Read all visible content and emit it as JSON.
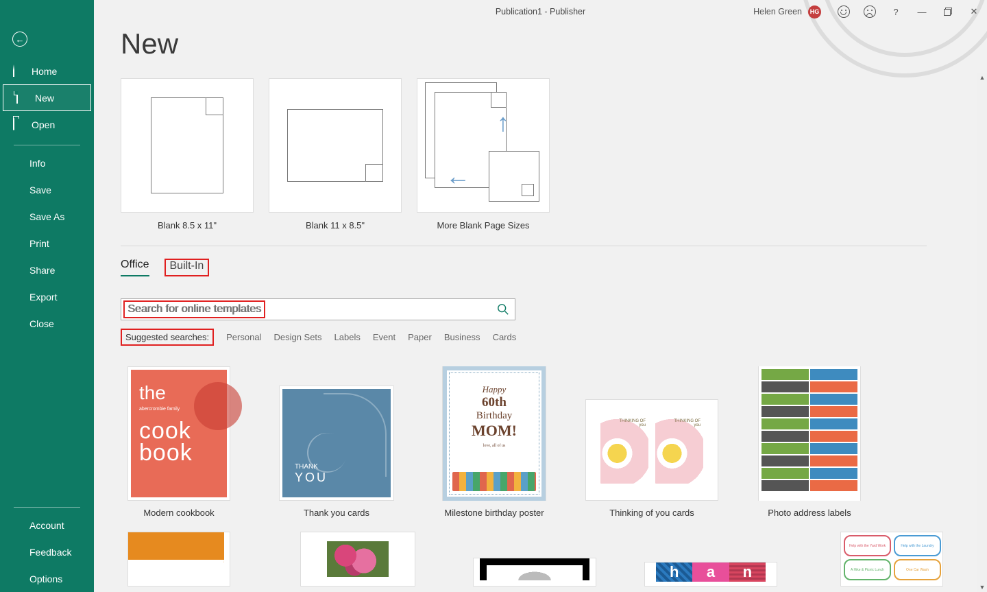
{
  "window": {
    "title": "Publication1  -  Publisher"
  },
  "user": {
    "name": "Helen Green",
    "initials": "HG"
  },
  "heading": "New",
  "sidebar": {
    "primary": [
      {
        "key": "home",
        "label": "Home"
      },
      {
        "key": "new",
        "label": "New"
      },
      {
        "key": "open",
        "label": "Open"
      }
    ],
    "secondary": [
      {
        "key": "info",
        "label": "Info"
      },
      {
        "key": "save",
        "label": "Save"
      },
      {
        "key": "saveas",
        "label": "Save As"
      },
      {
        "key": "print",
        "label": "Print"
      },
      {
        "key": "share",
        "label": "Share"
      },
      {
        "key": "export",
        "label": "Export"
      },
      {
        "key": "close",
        "label": "Close"
      }
    ],
    "bottom": [
      {
        "key": "account",
        "label": "Account"
      },
      {
        "key": "feedback",
        "label": "Feedback"
      },
      {
        "key": "options",
        "label": "Options"
      }
    ]
  },
  "blanks": [
    {
      "key": "portrait",
      "label": "Blank 8.5 x 11\""
    },
    {
      "key": "landscape",
      "label": "Blank 11 x 8.5\""
    },
    {
      "key": "more",
      "label": "More Blank Page Sizes"
    }
  ],
  "tabs": {
    "office": "Office",
    "builtin": "Built-In"
  },
  "search": {
    "placeholder": "Search for online templates"
  },
  "suggested": {
    "label": "Suggested searches:",
    "items": [
      "Personal",
      "Design Sets",
      "Labels",
      "Event",
      "Paper",
      "Business",
      "Cards"
    ]
  },
  "gallery1": [
    {
      "key": "cookbook",
      "label": "Modern cookbook"
    },
    {
      "key": "thankyou",
      "label": "Thank you cards"
    },
    {
      "key": "birthday",
      "label": "Milestone birthday poster"
    },
    {
      "key": "thinking",
      "label": "Thinking of you cards"
    },
    {
      "key": "photolabels",
      "label": "Photo address labels"
    }
  ],
  "cookbook": {
    "the": "the",
    "sub": "abercrombie family",
    "line1": "cook",
    "line2": "book"
  },
  "thankyou": {
    "t1": "THANK",
    "t2": "YOU"
  },
  "birthday": {
    "l1": "Happy",
    "l2": "60th",
    "l3": "Birthday",
    "l4": "MOM!",
    "l5": "love, all of us"
  },
  "han": {
    "c1": "h",
    "c2": "a",
    "c3": "n"
  }
}
